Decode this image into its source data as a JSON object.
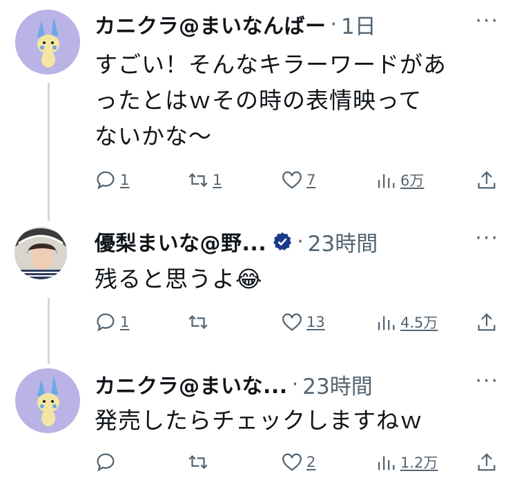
{
  "tweets": [
    {
      "name": "カニクラ@まいなんばー",
      "time": "1日",
      "text_lines": [
        "すごい！そんなキラーワードがあ",
        "ったとはｗその時の表情映って",
        "ないかな～"
      ],
      "replies": "1",
      "retweets": "1",
      "likes": "7",
      "views": "6万",
      "verified": false
    },
    {
      "name": "優梨まいな@野...",
      "time": "23時間",
      "text_lines": [
        "残ると思うよ😂"
      ],
      "replies": "1",
      "retweets": "",
      "likes": "13",
      "views": "4.5万",
      "verified": true
    },
    {
      "name": "カニクラ@まいな...",
      "time": "23時間",
      "text_lines": [
        "発売したらチェックしますねｗ"
      ],
      "replies": "",
      "retweets": "",
      "likes": "2",
      "views": "1.2万",
      "verified": false
    }
  ],
  "icons": {
    "reply": "reply-icon",
    "retweet": "retweet-icon",
    "like": "heart-icon",
    "views": "views-icon",
    "share": "share-icon",
    "more": "more-icon",
    "verified": "verified-badge-icon"
  },
  "colors": {
    "text": "#0f1419",
    "secondary": "#536471",
    "thread_line": "#cfd9de",
    "verified": "#1d3a8a",
    "avatar_bg": "#b9b3e6"
  },
  "separator": "·",
  "more_glyph": "···"
}
